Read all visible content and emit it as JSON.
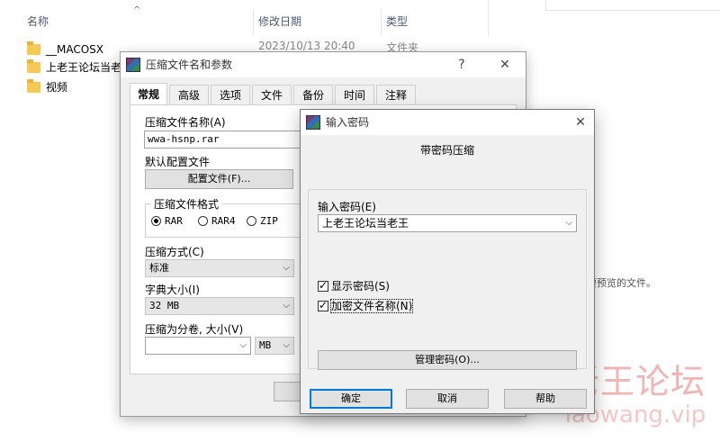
{
  "explorer": {
    "columns": {
      "name": "名称",
      "date": "修改日期",
      "type": "类型"
    },
    "sort_arrow": "^",
    "files": [
      {
        "name": "__MACOSX",
        "icon": "folder-icon"
      },
      {
        "name": "上老王论坛当老",
        "icon": "folder-icon"
      },
      {
        "name": "视频",
        "icon": "folder-icon"
      }
    ],
    "row1_date": "2023/10/13 20:40",
    "row1_type": "文件夹",
    "hint_text": "要预览的文件。",
    "watermark": {
      "title": "老王论坛",
      "url": "laowang.vip"
    }
  },
  "main_dialog": {
    "title": "压缩文件名和参数",
    "help_glyph": "?",
    "close_glyph": "✕",
    "tabs": [
      "常规",
      "高级",
      "选项",
      "文件",
      "备份",
      "时间",
      "注释"
    ],
    "archive_name_label": "压缩文件名称(A)",
    "archive_name_value": "wwa-hsnp.rar",
    "default_profile_label": "默认配置文件",
    "profile_button": "配置文件(F)...",
    "format_group_label": "压缩文件格式",
    "formats": [
      "RAR",
      "RAR4",
      "ZIP"
    ],
    "selected_format": "RAR",
    "method_label": "压缩方式(C)",
    "method_value": "标准",
    "dict_label": "字典大小(I)",
    "dict_value": "32 MB",
    "split_label": "压缩为分卷, 大小(V)",
    "split_value": "",
    "split_unit": "MB",
    "chevron": "⌵"
  },
  "password_dialog": {
    "title": "输入密码",
    "close_glyph": "✕",
    "heading": "带密码压缩",
    "enter_label": "输入密码(E)",
    "password_value": "上老王论坛当老王",
    "show_password_label": "显示密码(S)",
    "show_password_checked": true,
    "encrypt_names_label": "加密文件名称(N)",
    "encrypt_names_checked": true,
    "manage_button": "管理密码(O)...",
    "ok_button": "确定",
    "cancel_button": "取消",
    "help_button": "帮助",
    "chevron": "⌵"
  },
  "colors": {
    "accent": "#0078d7",
    "folder": "#f6c954",
    "watermark": "#f0b4b4"
  }
}
